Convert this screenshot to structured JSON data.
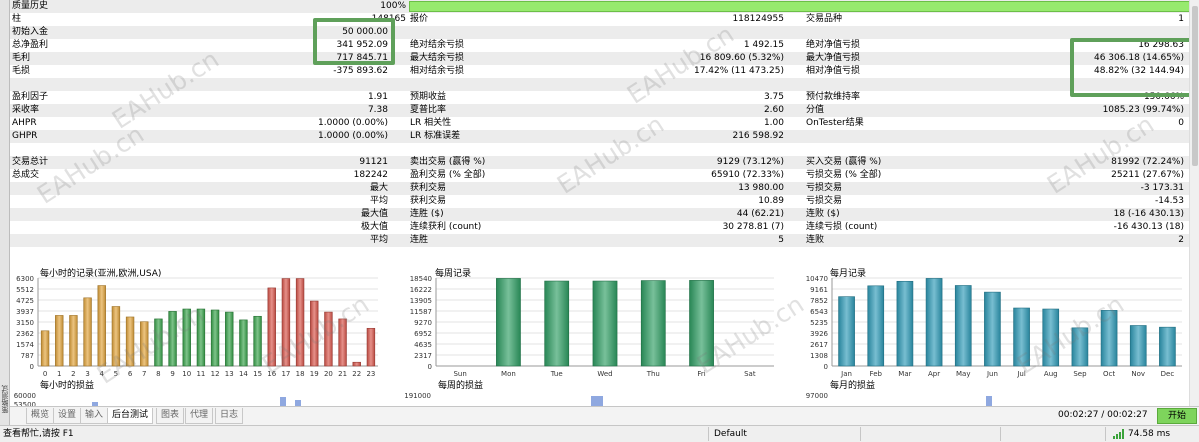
{
  "side_tab": "策略测试",
  "report": {
    "quality_label": "质量历史",
    "quality_value": "100%",
    "bars_label": "柱",
    "bars_value": "148165",
    "ticks_label": "报价",
    "ticks_value": "118124955",
    "symbols_label": "交易品种",
    "symbols_value": "1",
    "deposit_label": "初始入金",
    "deposit_value": "50 000.00",
    "net_label": "总净盈利",
    "net_value": "341 952.09",
    "abs_bal_dd_label": "绝对结余亏损",
    "abs_bal_dd_value": "1 492.15",
    "abs_eq_dd_label": "绝对净值亏损",
    "abs_eq_dd_value": "16 298.63",
    "gross_profit_label": "毛利",
    "gross_profit_value": "717 845.71",
    "max_bal_dd_label": "最大结余亏损",
    "max_bal_dd_value": "16 809.60 (5.32%)",
    "max_eq_dd_label": "最大净值亏损",
    "max_eq_dd_value": "46 306.18 (14.65%)",
    "gross_loss_label": "毛损",
    "gross_loss_value": "-375 893.62",
    "rel_bal_dd_label": "相对结余亏损",
    "rel_bal_dd_value": "17.42% (11 473.25)",
    "rel_eq_dd_label": "相对净值亏损",
    "rel_eq_dd_value": "48.82% (32 144.94)",
    "pf_label": "盈利因子",
    "pf_value": "1.91",
    "exp_payoff_label": "预期收益",
    "exp_payoff_value": "3.75",
    "margin_level_label": "预付款维持率",
    "margin_level_value": "150.66%",
    "recovery_label": "采收率",
    "recovery_value": "7.38",
    "sharpe_label": "夏普比率",
    "sharpe_value": "2.60",
    "zscore_label": "分值",
    "zscore_value": "1085.23 (99.74%)",
    "ahpr_label": "AHPR",
    "ahpr_value": "1.0000 (0.00%)",
    "lr_corr_label": "LR 相关性",
    "lr_corr_value": "1.00",
    "ontester_label": "OnTester结果",
    "ontester_value": "0",
    "ghpr_label": "GHPR",
    "ghpr_value": "1.0000 (0.00%)",
    "lr_err_label": "LR 标准误差",
    "lr_err_value": "216 598.92",
    "total_trades_label": "交易总计",
    "total_trades_value": "91121",
    "short_label": "卖出交易 (赢得 %)",
    "short_value": "9129 (73.12%)",
    "long_label": "买入交易 (赢得 %)",
    "long_value": "81992 (72.24%)",
    "total_deals_label": "总成交",
    "total_deals_value": "182242",
    "profit_trades_label": "盈利交易 (% 全部)",
    "profit_trades_value": "65910 (72.33%)",
    "loss_trades_label": "亏损交易 (% 全部)",
    "loss_trades_value": "25211 (27.67%)",
    "largest_label": "最大",
    "largest_profit_label": "获利交易",
    "largest_profit_value": "13 980.00",
    "largest_loss_label": "亏损交易",
    "largest_loss_value": "-3 173.31",
    "average_label": "平均",
    "avg_profit_label": "获利交易",
    "avg_profit_value": "10.89",
    "avg_loss_label": "亏损交易",
    "avg_loss_value": "-14.53",
    "maximum_label": "最大值",
    "max_wins_label": "连胜 ($)",
    "max_wins_value": "44 (62.21)",
    "max_losses_label": "连败 ($)",
    "max_losses_value": "18 (-16 430.13)",
    "maximal_label": "极大值",
    "max_profit_label": "连续获利 (count)",
    "max_profit_value": "30 278.81 (7)",
    "max_loss_label": "连续亏损 (count)",
    "max_loss_value": "-16 430.13 (18)",
    "avg2_label": "平均",
    "avg_wins_label": "连胜",
    "avg_wins_value": "5",
    "avg_losses_label": "连败",
    "avg_losses_value": "2"
  },
  "chart_data": [
    {
      "type": "bar",
      "title": "每小时的记录(亚洲,欧洲,USA)",
      "ticks": [
        "0",
        "787",
        "1574",
        "2362",
        "3150",
        "3937",
        "4725",
        "5512",
        "6300"
      ],
      "ylim": [
        0,
        6300
      ],
      "categories": [
        "0",
        "1",
        "2",
        "3",
        "4",
        "5",
        "6",
        "7",
        "8",
        "9",
        "10",
        "11",
        "12",
        "13",
        "14",
        "15",
        "16",
        "17",
        "18",
        "19",
        "20",
        "21",
        "22",
        "23"
      ],
      "values": [
        2520,
        3620,
        3620,
        4880,
        5760,
        4260,
        3510,
        3170,
        3370,
        3910,
        4080,
        4080,
        4010,
        3860,
        3300,
        3560,
        5590,
        6260,
        6260,
        4650,
        3860,
        3370,
        270,
        2700
      ],
      "colors": [
        "#e1a43c",
        "#e1a43c",
        "#e1a43c",
        "#e1a43c",
        "#e1a43c",
        "#e1a43c",
        "#e1a43c",
        "#e1a43c",
        "#39a34b",
        "#39a34b",
        "#39a34b",
        "#39a34b",
        "#39a34b",
        "#39a34b",
        "#39a34b",
        "#39a34b",
        "#d9564b",
        "#d9564b",
        "#d9564b",
        "#d9564b",
        "#d9564b",
        "#d9564b",
        "#d9564b",
        "#d9564b"
      ]
    },
    {
      "type": "bar",
      "title": "每周记录",
      "ticks": [
        "0",
        "2317",
        "4635",
        "6952",
        "9270",
        "11587",
        "13905",
        "16222",
        "18540"
      ],
      "ylim": [
        0,
        18540
      ],
      "categories": [
        "Sun",
        "Mon",
        "Tue",
        "Wed",
        "Thu",
        "Fri",
        "Sat"
      ],
      "values": [
        0,
        18450,
        17900,
        17900,
        18000,
        18040,
        0
      ],
      "colors": [
        "#2f9e64"
      ]
    },
    {
      "type": "bar",
      "title": "每月记录",
      "ticks": [
        "0",
        "1308",
        "2617",
        "3926",
        "5235",
        "6543",
        "7852",
        "9161",
        "10470"
      ],
      "ylim": [
        0,
        10470
      ],
      "categories": [
        "Jan",
        "Feb",
        "Mar",
        "Apr",
        "May",
        "Jun",
        "Jul",
        "Aug",
        "Sep",
        "Oct",
        "Nov",
        "Dec"
      ],
      "values": [
        8250,
        9540,
        10080,
        10420,
        9580,
        8790,
        6900,
        6780,
        4540,
        6620,
        4820,
        4620
      ],
      "colors": [
        "#2f9bb8"
      ]
    },
    {
      "type": "bar",
      "title": "每小时的损益",
      "ticks": [
        "60000",
        "53500"
      ],
      "ylim": [
        53500,
        60000
      ],
      "categories": [],
      "values": [],
      "colors": [
        "#8fa8e0"
      ]
    },
    {
      "type": "bar",
      "title": "每周的损益",
      "ticks": [
        "191000"
      ],
      "ylim": [
        0,
        191000
      ],
      "categories": [],
      "values": [],
      "colors": [
        "#8fa8e0"
      ]
    },
    {
      "type": "bar",
      "title": "每月的损益",
      "ticks": [
        "97000"
      ],
      "ylim": [
        0,
        97000
      ],
      "categories": [],
      "values": [],
      "colors": [
        "#8fa8e0"
      ]
    }
  ],
  "tabs": [
    "概览",
    "设置",
    "输入",
    "后台测试",
    "图表",
    "代理",
    "日志"
  ],
  "time_value": "00:02:27 / 00:02:27",
  "start_label": "开始",
  "status": {
    "help": "查看帮忙,请按 F1",
    "profile": "Default",
    "ping": "74.58 ms"
  },
  "watermark": "EAHub.cn"
}
